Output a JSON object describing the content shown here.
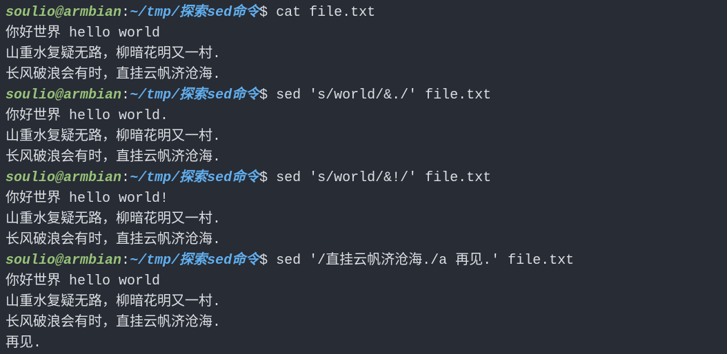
{
  "prompt": {
    "user": "soulio",
    "at": "@",
    "host": "armbian",
    "colon": ":",
    "path": "~/tmp/探索sed命令",
    "dollar": "$ "
  },
  "blocks": [
    {
      "command": "cat file.txt",
      "output": [
        "你好世界 hello world",
        "山重水复疑无路，柳暗花明又一村.",
        "长风破浪会有时，直挂云帆济沧海."
      ]
    },
    {
      "command": "sed 's/world/&./' file.txt",
      "output": [
        "你好世界 hello world.",
        "山重水复疑无路，柳暗花明又一村.",
        "长风破浪会有时，直挂云帆济沧海."
      ]
    },
    {
      "command": "sed 's/world/&!/' file.txt",
      "output": [
        "你好世界 hello world!",
        "山重水复疑无路，柳暗花明又一村.",
        "长风破浪会有时，直挂云帆济沧海."
      ]
    },
    {
      "command": "sed '/直挂云帆济沧海./a 再见.' file.txt",
      "output": [
        "你好世界 hello world",
        "山重水复疑无路，柳暗花明又一村.",
        "长风破浪会有时，直挂云帆济沧海.",
        "再见."
      ]
    }
  ]
}
